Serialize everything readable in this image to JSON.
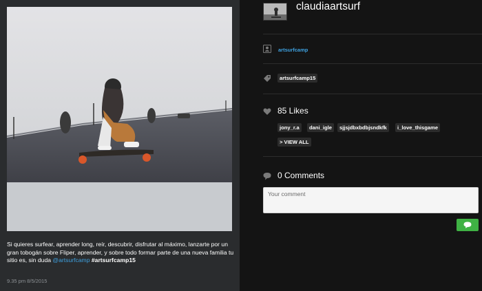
{
  "colors": {
    "accent_link": "#3ea1e0",
    "send_button": "#3fb244",
    "panel_left": "#2a2c2e",
    "panel_right": "#141414",
    "tag_bg": "#2c2c2c"
  },
  "post": {
    "caption_text": "Si quieres surfear, aprender long, reír, descubrir, disfrutar al máximo, lanzarte por un gran tobogán sobre Fliper, aprender, y sobre todo formar parte de una nueva familia tu sitio es, sin duda",
    "caption_mention": "@artsurfcamp",
    "caption_hashtag": "#artsurfcamp15",
    "timestamp": "9.35 pm 8/5/2015"
  },
  "author": {
    "username": "claudiaartsurf"
  },
  "location": {
    "icon": "person-pin-icon",
    "label": "artsurfcamp"
  },
  "tags": {
    "icon": "tag-icon",
    "items": [
      "artsurfcamp15"
    ]
  },
  "likes": {
    "icon": "heart-icon",
    "label": "85 Likes",
    "users": [
      "jony_r.a",
      "dani_igle",
      "sjjsjdbxbdbjsndkfk",
      "i_love_thisgame"
    ],
    "view_all": "> VIEW ALL"
  },
  "comments": {
    "icon": "speech-bubble-icon",
    "label": "0 Comments",
    "placeholder": "Your comment",
    "send_icon": "chat-bubble-icon"
  }
}
